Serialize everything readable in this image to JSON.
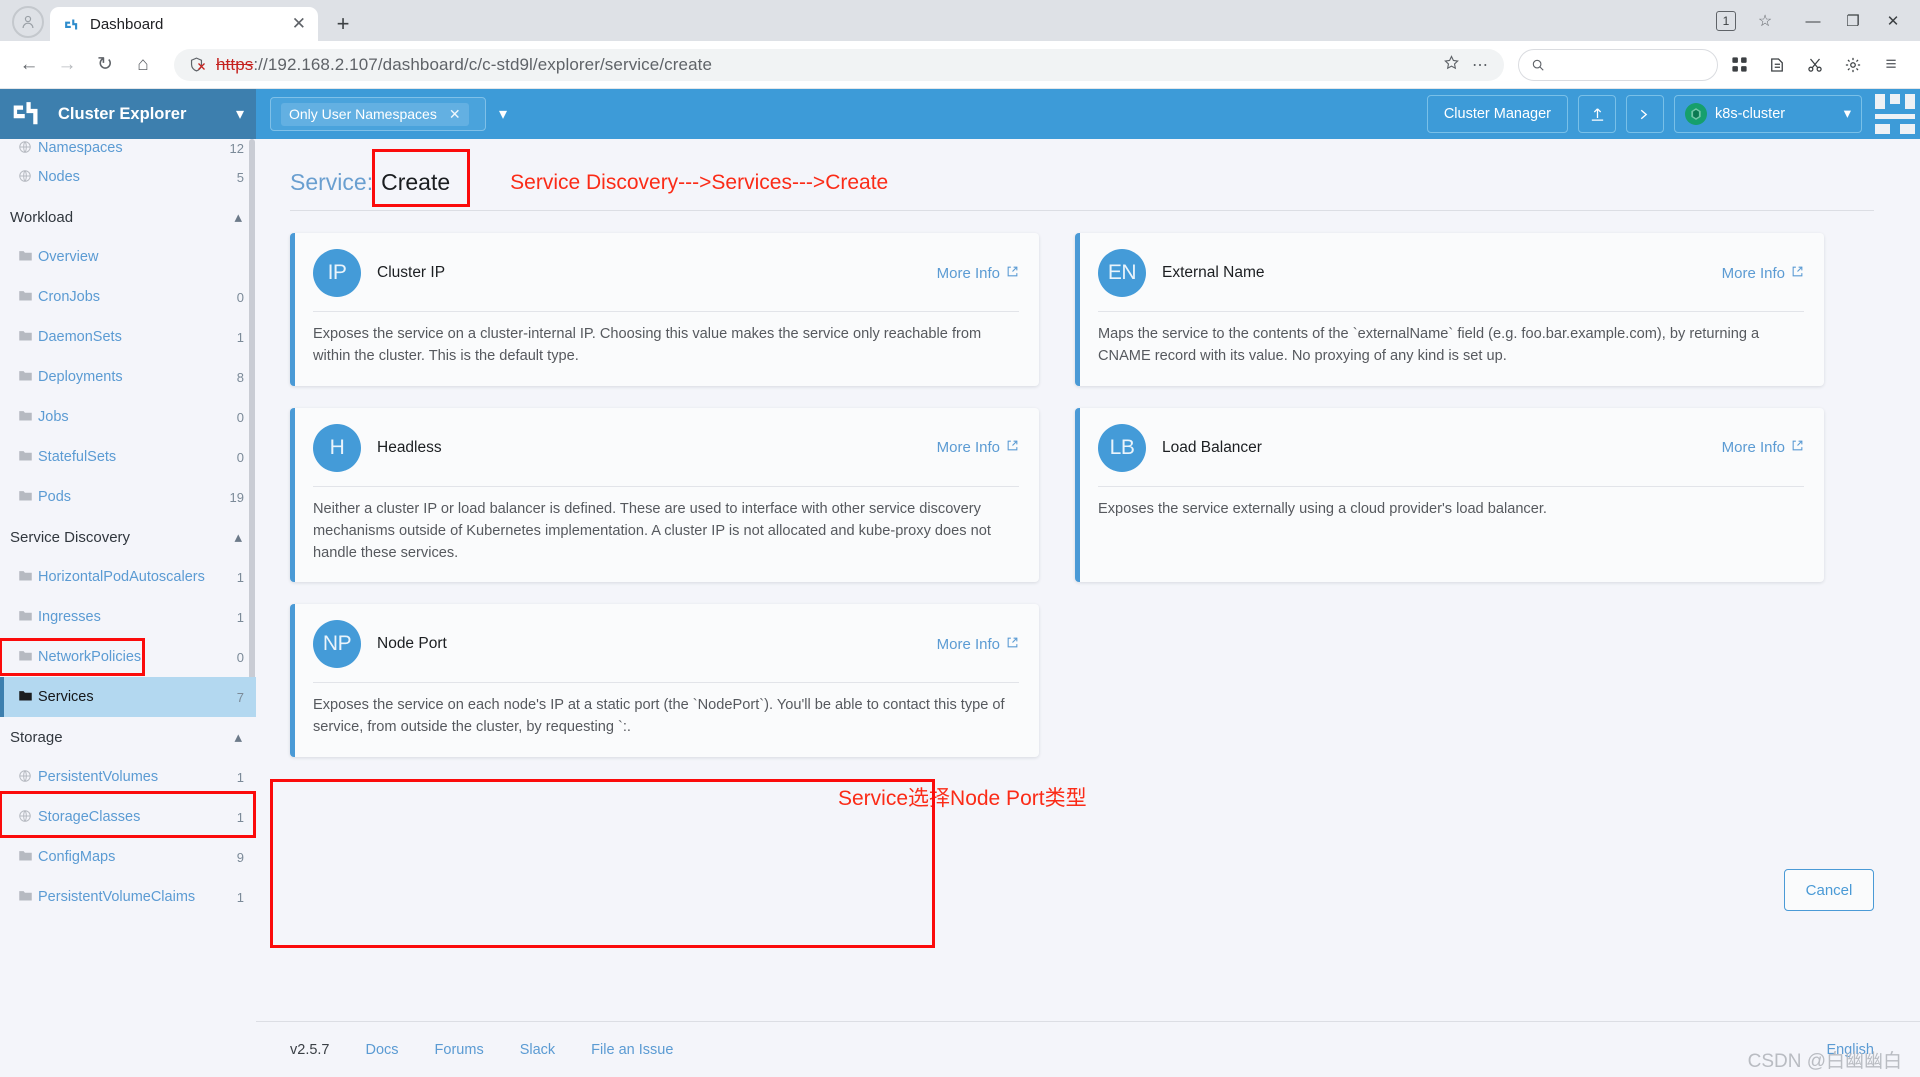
{
  "browser": {
    "tab": {
      "title": "Dashboard",
      "favicon_icon": "rancher-favicon",
      "close_icon": "close-icon"
    },
    "newtab_icon": "plus-icon",
    "nav": {
      "back_icon": "arrow-left-icon",
      "forward_icon": "arrow-right-icon",
      "reload_icon": "reload-icon",
      "home_icon": "home-icon"
    },
    "omnibox": {
      "shield_icon": "shield-warning-icon",
      "scheme": "https",
      "rest": "://192.168.2.107/dashboard/c/c-std9l/explorer/service/create",
      "host": "192.168.2.107",
      "path": "/dashboard/c/c-std9l/explorer/service/create",
      "star_icon": "star-icon",
      "more_icon": "more-dots-icon"
    },
    "search": {
      "placeholder": "",
      "icon": "search-icon"
    },
    "right_icons": [
      "apps-grid-icon",
      "collections-icon",
      "cut-icon",
      "settings-icon",
      "menu-icon"
    ],
    "tab_count": "1",
    "window_controls": {
      "minimize": "—",
      "maximize": "❐",
      "close": "✕"
    }
  },
  "sidebar": {
    "title": "Cluster Explorer",
    "collapse_icon": "chevron-down-icon",
    "scroll_clipped_item": {
      "label": "Namespaces",
      "count": "12",
      "icon": "globe-icon"
    },
    "items": [
      {
        "type": "link",
        "label": "Nodes",
        "count": "5",
        "icon": "globe-icon"
      },
      {
        "type": "group",
        "label": "Workload",
        "chevron": "chevron-up-icon"
      },
      {
        "type": "link",
        "label": "Overview",
        "count": "",
        "icon": "folder-icon"
      },
      {
        "type": "link",
        "label": "CronJobs",
        "count": "0",
        "icon": "folder-icon"
      },
      {
        "type": "link",
        "label": "DaemonSets",
        "count": "1",
        "icon": "folder-icon"
      },
      {
        "type": "link",
        "label": "Deployments",
        "count": "8",
        "icon": "folder-icon"
      },
      {
        "type": "link",
        "label": "Jobs",
        "count": "0",
        "icon": "folder-icon"
      },
      {
        "type": "link",
        "label": "StatefulSets",
        "count": "0",
        "icon": "folder-icon"
      },
      {
        "type": "link",
        "label": "Pods",
        "count": "19",
        "icon": "folder-icon"
      },
      {
        "type": "group",
        "label": "Service Discovery",
        "chevron": "chevron-up-icon",
        "highlighted": true
      },
      {
        "type": "link",
        "label": "HorizontalPodAutoscalers",
        "count": "1",
        "icon": "folder-icon"
      },
      {
        "type": "link",
        "label": "Ingresses",
        "count": "1",
        "icon": "folder-icon"
      },
      {
        "type": "link",
        "label": "NetworkPolicies",
        "count": "0",
        "icon": "folder-icon"
      },
      {
        "type": "link",
        "label": "Services",
        "count": "7",
        "icon": "folder-icon",
        "active": true,
        "highlighted": true
      },
      {
        "type": "group",
        "label": "Storage",
        "chevron": "chevron-up-icon"
      },
      {
        "type": "link",
        "label": "PersistentVolumes",
        "count": "1",
        "icon": "globe-icon"
      },
      {
        "type": "link",
        "label": "StorageClasses",
        "count": "1",
        "icon": "globe-icon"
      },
      {
        "type": "link",
        "label": "ConfigMaps",
        "count": "9",
        "icon": "folder-icon"
      },
      {
        "type": "link",
        "label": "PersistentVolumeClaims",
        "count": "1",
        "icon": "folder-icon"
      }
    ]
  },
  "topbar": {
    "namespace_filter": {
      "pill_label": "Only User Namespaces",
      "remove_icon": "close-icon",
      "caret_icon": "chevron-down-icon"
    },
    "cluster_manager_label": "Cluster Manager",
    "import_icon": "upload-icon",
    "shell_icon": "terminal-icon",
    "cluster_selector": {
      "name": "k8s-cluster",
      "icon": "cluster-icon",
      "caret_icon": "chevron-down-icon"
    },
    "logo_icon": "rancher-grid-logo"
  },
  "page": {
    "breadcrumb_prefix": "Service:",
    "title_current": "Create",
    "annotation_path": "Service Discovery--->Services--->Create",
    "annotation_nodeport": "Service选择Node Port类型",
    "more_info_label": "More Info",
    "more_info_icon": "external-link-icon",
    "cancel_label": "Cancel",
    "cards": [
      {
        "badge": "IP",
        "name": "Cluster IP",
        "desc": "Exposes the service on a cluster-internal IP. Choosing this value makes the service only reachable from within the cluster. This is the default type."
      },
      {
        "badge": "EN",
        "name": "External Name",
        "desc": "Maps the service to the contents of the `externalName` field (e.g. foo.bar.example.com), by returning a CNAME record with its value. No proxying of any kind is set up."
      },
      {
        "badge": "H",
        "name": "Headless",
        "desc": "Neither a cluster IP or load balancer is defined. These are used to interface with other service discovery mechanisms outside of Kubernetes implementation. A cluster IP is not allocated and kube-proxy does not handle these services."
      },
      {
        "badge": "LB",
        "name": "Load Balancer",
        "desc": "Exposes the service externally using a cloud provider's load balancer."
      },
      {
        "badge": "NP",
        "name": "Node Port",
        "desc": "Exposes the service on each node's IP at a static port (the `NodePort`). You'll be able to contact this type of service, from outside the cluster, by requesting `:.",
        "highlighted": true
      }
    ]
  },
  "footer": {
    "version": "v2.5.7",
    "links": [
      "Docs",
      "Forums",
      "Slack",
      "File an Issue"
    ],
    "language": "English",
    "watermark": "CSDN @白幽幽白"
  },
  "colors": {
    "brand_blue": "#3d9bd8",
    "sidebar_header": "#3d7fae",
    "annotation_red": "#fb2b17",
    "link_blue": "#5b9bd3",
    "active_row": "#b3d8f0"
  }
}
